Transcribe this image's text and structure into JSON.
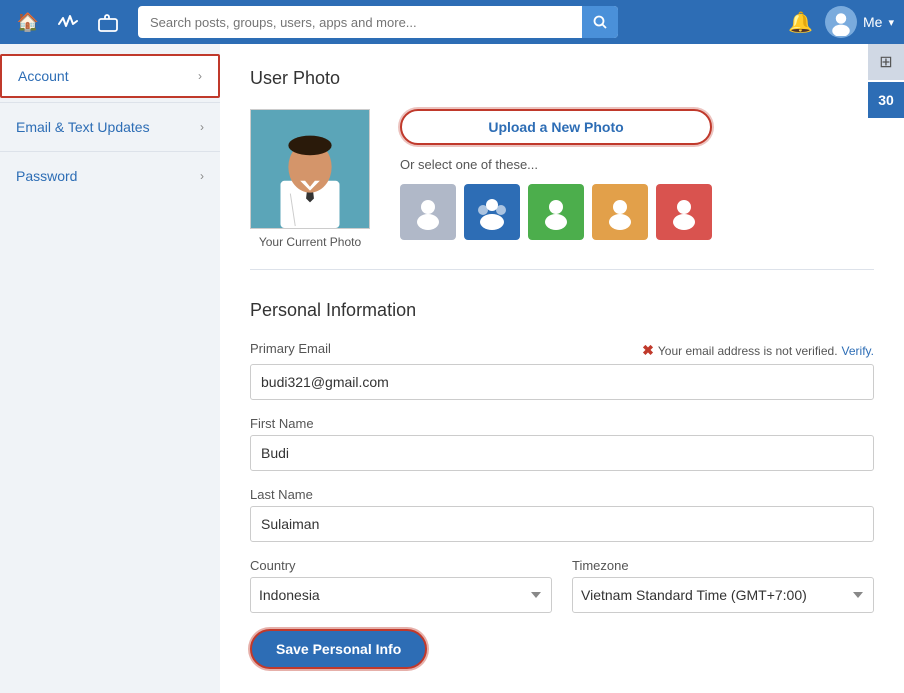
{
  "topnav": {
    "search_placeholder": "Search posts, groups, users, apps and more...",
    "me_label": "Me",
    "home_icon": "🏠",
    "pulse_icon": "〜",
    "briefcase_icon": "📋",
    "bell_icon": "🔔",
    "chevron_icon": "▾"
  },
  "side_widgets": {
    "grid_icon": "⊞",
    "calendar_label": "30"
  },
  "sidebar": {
    "items": [
      {
        "label": "Account",
        "active": true
      },
      {
        "label": "Email & Text Updates",
        "active": false
      },
      {
        "label": "Password",
        "active": false
      }
    ]
  },
  "user_photo": {
    "section_title": "User Photo",
    "current_photo_label": "Your Current Photo",
    "upload_btn_label": "Upload a New Photo",
    "or_select_label": "Or select one of these...",
    "avatar_colors": [
      "#b0b8c8",
      "#2d6db5",
      "#4cae4c",
      "#e2a04a",
      "#d9534f"
    ]
  },
  "personal_info": {
    "section_title": "Personal Information",
    "primary_email_label": "Primary Email",
    "primary_email_value": "budi321@gmail.com",
    "email_warning": "Your email address is not verified.",
    "verify_label": "Verify.",
    "first_name_label": "First Name",
    "first_name_value": "Budi",
    "last_name_label": "Last Name",
    "last_name_value": "Sulaiman",
    "country_label": "Country",
    "country_value": "Indonesia",
    "timezone_label": "Timezone",
    "timezone_value": "Vietnam Standard Time (GMT+7:00)",
    "save_btn_label": "Save Personal Info"
  }
}
